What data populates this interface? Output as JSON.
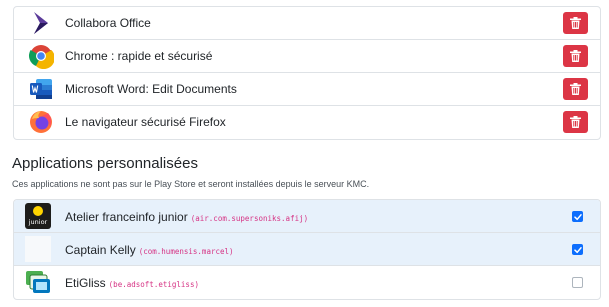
{
  "store_apps": [
    {
      "name": "Collabora Office",
      "icon": "collabora-office-icon"
    },
    {
      "name": "Chrome : rapide et sécurisé",
      "icon": "chrome-icon"
    },
    {
      "name": "Microsoft Word: Edit Documents",
      "icon": "microsoft-word-icon"
    },
    {
      "name": "Le navigateur sécurisé Firefox",
      "icon": "firefox-icon"
    }
  ],
  "delete_icon": "trash-icon",
  "colors": {
    "danger": "#dc3545",
    "primary": "#0d6efd",
    "selected_row": "#e7f1fb",
    "code": "#d63384"
  },
  "custom_section": {
    "title": "Applications personnalisées",
    "description": "Ces applications ne sont pas sur le Play Store et seront installées depuis le serveur KMC.",
    "apps": [
      {
        "name": "Atelier franceinfo junior",
        "package": "(air.com.supersoniks.afij)",
        "checked": true,
        "icon": "franceinfo-junior-icon",
        "icon_text": "junior"
      },
      {
        "name": "Captain Kelly",
        "package": "(com.humensis.marcel)",
        "checked": true,
        "icon": "blank-app-icon"
      },
      {
        "name": "EtiGliss",
        "package": "(be.adsoft.etigliss)",
        "checked": false,
        "icon": "etigliss-icon"
      }
    ]
  }
}
